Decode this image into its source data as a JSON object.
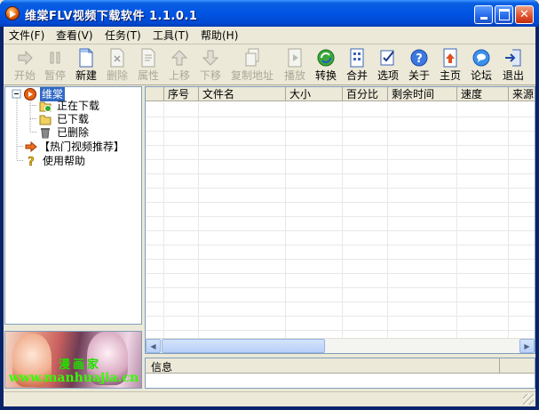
{
  "window": {
    "title": "维棠FLV视频下载软件  1.1.0.1"
  },
  "menu": [
    {
      "label": "文件(F)"
    },
    {
      "label": "查看(V)"
    },
    {
      "label": "任务(T)"
    },
    {
      "label": "工具(T)"
    },
    {
      "label": "帮助(H)"
    }
  ],
  "toolbar": [
    {
      "label": "开始",
      "icon": "arrow-right-icon",
      "enabled": false
    },
    {
      "label": "暂停",
      "icon": "pause-icon",
      "enabled": false
    },
    {
      "label": "新建",
      "icon": "new-document-icon",
      "enabled": true
    },
    {
      "label": "删除",
      "icon": "delete-document-icon",
      "enabled": false
    },
    {
      "label": "属性",
      "icon": "properties-icon",
      "enabled": false
    },
    {
      "label": "上移",
      "icon": "arrow-up-icon",
      "enabled": false
    },
    {
      "label": "下移",
      "icon": "arrow-down-icon",
      "enabled": false
    },
    {
      "label": "复制地址",
      "icon": "copy-icon",
      "enabled": false
    },
    {
      "label": "播放",
      "icon": "play-icon",
      "enabled": false
    },
    {
      "label": "转换",
      "icon": "convert-icon",
      "enabled": true
    },
    {
      "label": "合并",
      "icon": "merge-icon",
      "enabled": true
    },
    {
      "label": "选项",
      "icon": "options-icon",
      "enabled": true
    },
    {
      "label": "关于",
      "icon": "help-icon",
      "enabled": true
    },
    {
      "label": "主页",
      "icon": "homepage-icon",
      "enabled": true
    },
    {
      "label": "论坛",
      "icon": "forum-icon",
      "enabled": true
    },
    {
      "label": "退出",
      "icon": "exit-icon",
      "enabled": true
    }
  ],
  "tree": {
    "root": "维棠",
    "children": [
      "正在下载",
      "已下载",
      "已删除"
    ],
    "hot": "【热门视频推荐】",
    "help": "使用帮助"
  },
  "banner": {
    "text1": "漫画家",
    "text2": "www.manhuajia.cn"
  },
  "table": {
    "columns": [
      "",
      "序号",
      "文件名",
      "大小",
      "百分比",
      "剩余时间",
      "速度",
      "来源"
    ]
  },
  "info": {
    "header": "信息"
  }
}
